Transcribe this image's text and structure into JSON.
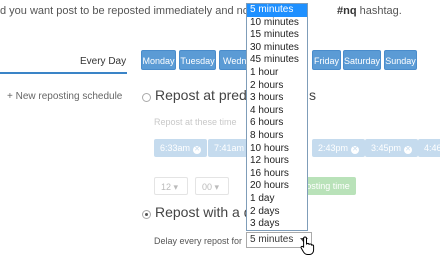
{
  "intro": {
    "text_start": "d you want post to be reposted immediately and not schedul",
    "hashtag": "#nq",
    "text_end": " hashtag."
  },
  "tabs": {
    "every_day": "Every Day"
  },
  "days": [
    "Monday",
    "Tuesday",
    "Wedne",
    "Friday",
    "Saturday",
    "Sunday"
  ],
  "sidebar": {
    "new_schedule": "+ New reposting schedule"
  },
  "option_predefined": {
    "heading_start": "Repost at prede",
    "heading_end": "s",
    "sub": "Repost at these time",
    "times": [
      "6:33am",
      "7:41am",
      "2:43pm",
      "3:45pm",
      "4:46"
    ],
    "hour": "12",
    "minute": "00",
    "add_button": "osting time"
  },
  "option_delay": {
    "heading": "Repost with a d",
    "label": "Delay every repost for",
    "selected": "5 minutes"
  },
  "dropdown": {
    "options": [
      "5 minutes",
      "10 minutes",
      "15 minutes",
      "30 minutes",
      "45 minutes",
      "1 hour",
      "2 hours",
      "3 hours",
      "4 hours",
      "6 hours",
      "8 hours",
      "10 hours",
      "12 hours",
      "16 hours",
      "20 hours",
      "1 day",
      "2 days",
      "3 days"
    ],
    "highlighted_index": 0
  },
  "colors": {
    "day_button": "#5b9bd5",
    "time_chip": "#c5dbee",
    "highlight": "#1e90ff",
    "add_button": "#b9e2b9"
  }
}
